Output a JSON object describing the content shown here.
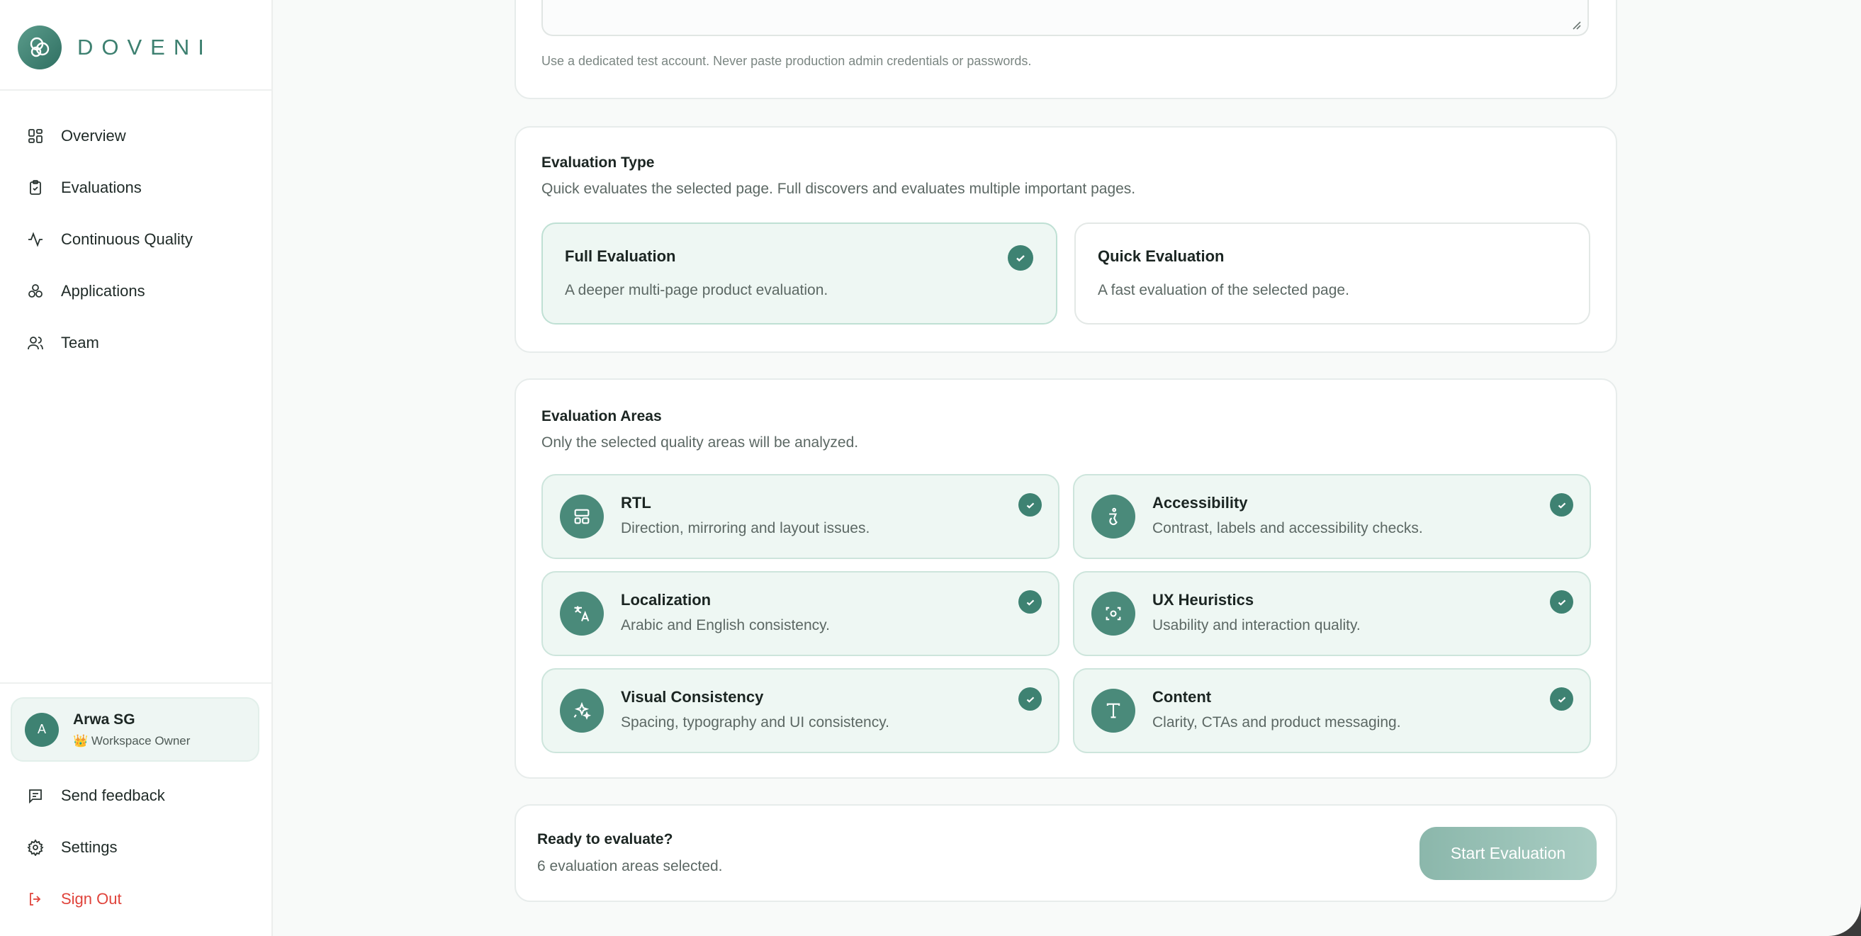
{
  "brand": {
    "name": "DOVENI"
  },
  "sidebar": {
    "nav": [
      {
        "label": "Overview",
        "icon": "grid-icon"
      },
      {
        "label": "Evaluations",
        "icon": "clipboard-check-icon"
      },
      {
        "label": "Continuous Quality",
        "icon": "activity-icon"
      },
      {
        "label": "Applications",
        "icon": "apps-cluster-icon"
      },
      {
        "label": "Team",
        "icon": "users-icon"
      }
    ],
    "user": {
      "initial": "A",
      "name": "Arwa SG",
      "role": "👑 Workspace Owner"
    },
    "footer": [
      {
        "label": "Send feedback",
        "icon": "message-icon"
      },
      {
        "label": "Settings",
        "icon": "gear-icon"
      },
      {
        "label": "Sign Out",
        "icon": "sign-out-icon"
      }
    ]
  },
  "credentials": {
    "hint": "Use a dedicated test account. Never paste production admin credentials or passwords."
  },
  "evaluation_type": {
    "title": "Evaluation Type",
    "subtitle": "Quick evaluates the selected page. Full discovers and evaluates multiple important pages.",
    "options": [
      {
        "title": "Full Evaluation",
        "desc": "A deeper multi-page product evaluation.",
        "selected": true
      },
      {
        "title": "Quick Evaluation",
        "desc": "A fast evaluation of the selected page.",
        "selected": false
      }
    ]
  },
  "evaluation_areas": {
    "title": "Evaluation Areas",
    "subtitle": "Only the selected quality areas will be analyzed.",
    "items": [
      {
        "title": "RTL",
        "desc": "Direction, mirroring and layout issues.",
        "icon": "layout-icon",
        "selected": true
      },
      {
        "title": "Accessibility",
        "desc": "Contrast, labels and accessibility checks.",
        "icon": "accessibility-icon",
        "selected": true
      },
      {
        "title": "Localization",
        "desc": "Arabic and English consistency.",
        "icon": "translate-icon",
        "selected": true
      },
      {
        "title": "UX Heuristics",
        "desc": "Usability and interaction quality.",
        "icon": "scan-icon",
        "selected": true
      },
      {
        "title": "Visual Consistency",
        "desc": "Spacing, typography and UI consistency.",
        "icon": "sparkles-icon",
        "selected": true
      },
      {
        "title": "Content",
        "desc": "Clarity, CTAs and product messaging.",
        "icon": "text-icon",
        "selected": true
      }
    ]
  },
  "ready": {
    "title": "Ready to evaluate?",
    "subtitle": "6 evaluation areas selected.",
    "button": "Start Evaluation"
  },
  "colors": {
    "accent": "#3e8272",
    "danger": "#e0433b",
    "selected_bg": "#eef7f3"
  }
}
